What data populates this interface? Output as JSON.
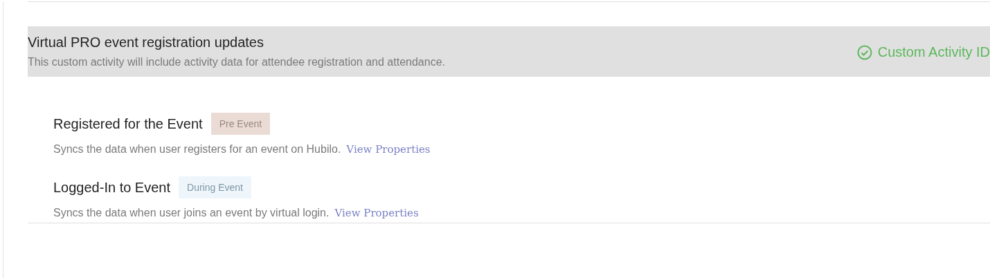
{
  "section": {
    "title": "Virtual PRO event registration updates",
    "description": "This custom activity will include activity data for attendee registration and attendance.",
    "status": "Custom Activity ID"
  },
  "activities": [
    {
      "name": "Registered for the Event",
      "tag": {
        "label": "Pre Event",
        "kind": "pre"
      },
      "description": "Syncs the data when user registers for an event on Hubilo.",
      "link": "View Properties"
    },
    {
      "name": "Logged-In to Event",
      "tag": {
        "label": "During Event",
        "kind": "during"
      },
      "description": "Syncs the data when user joins an event by virtual login.",
      "link": "View Properties"
    }
  ]
}
